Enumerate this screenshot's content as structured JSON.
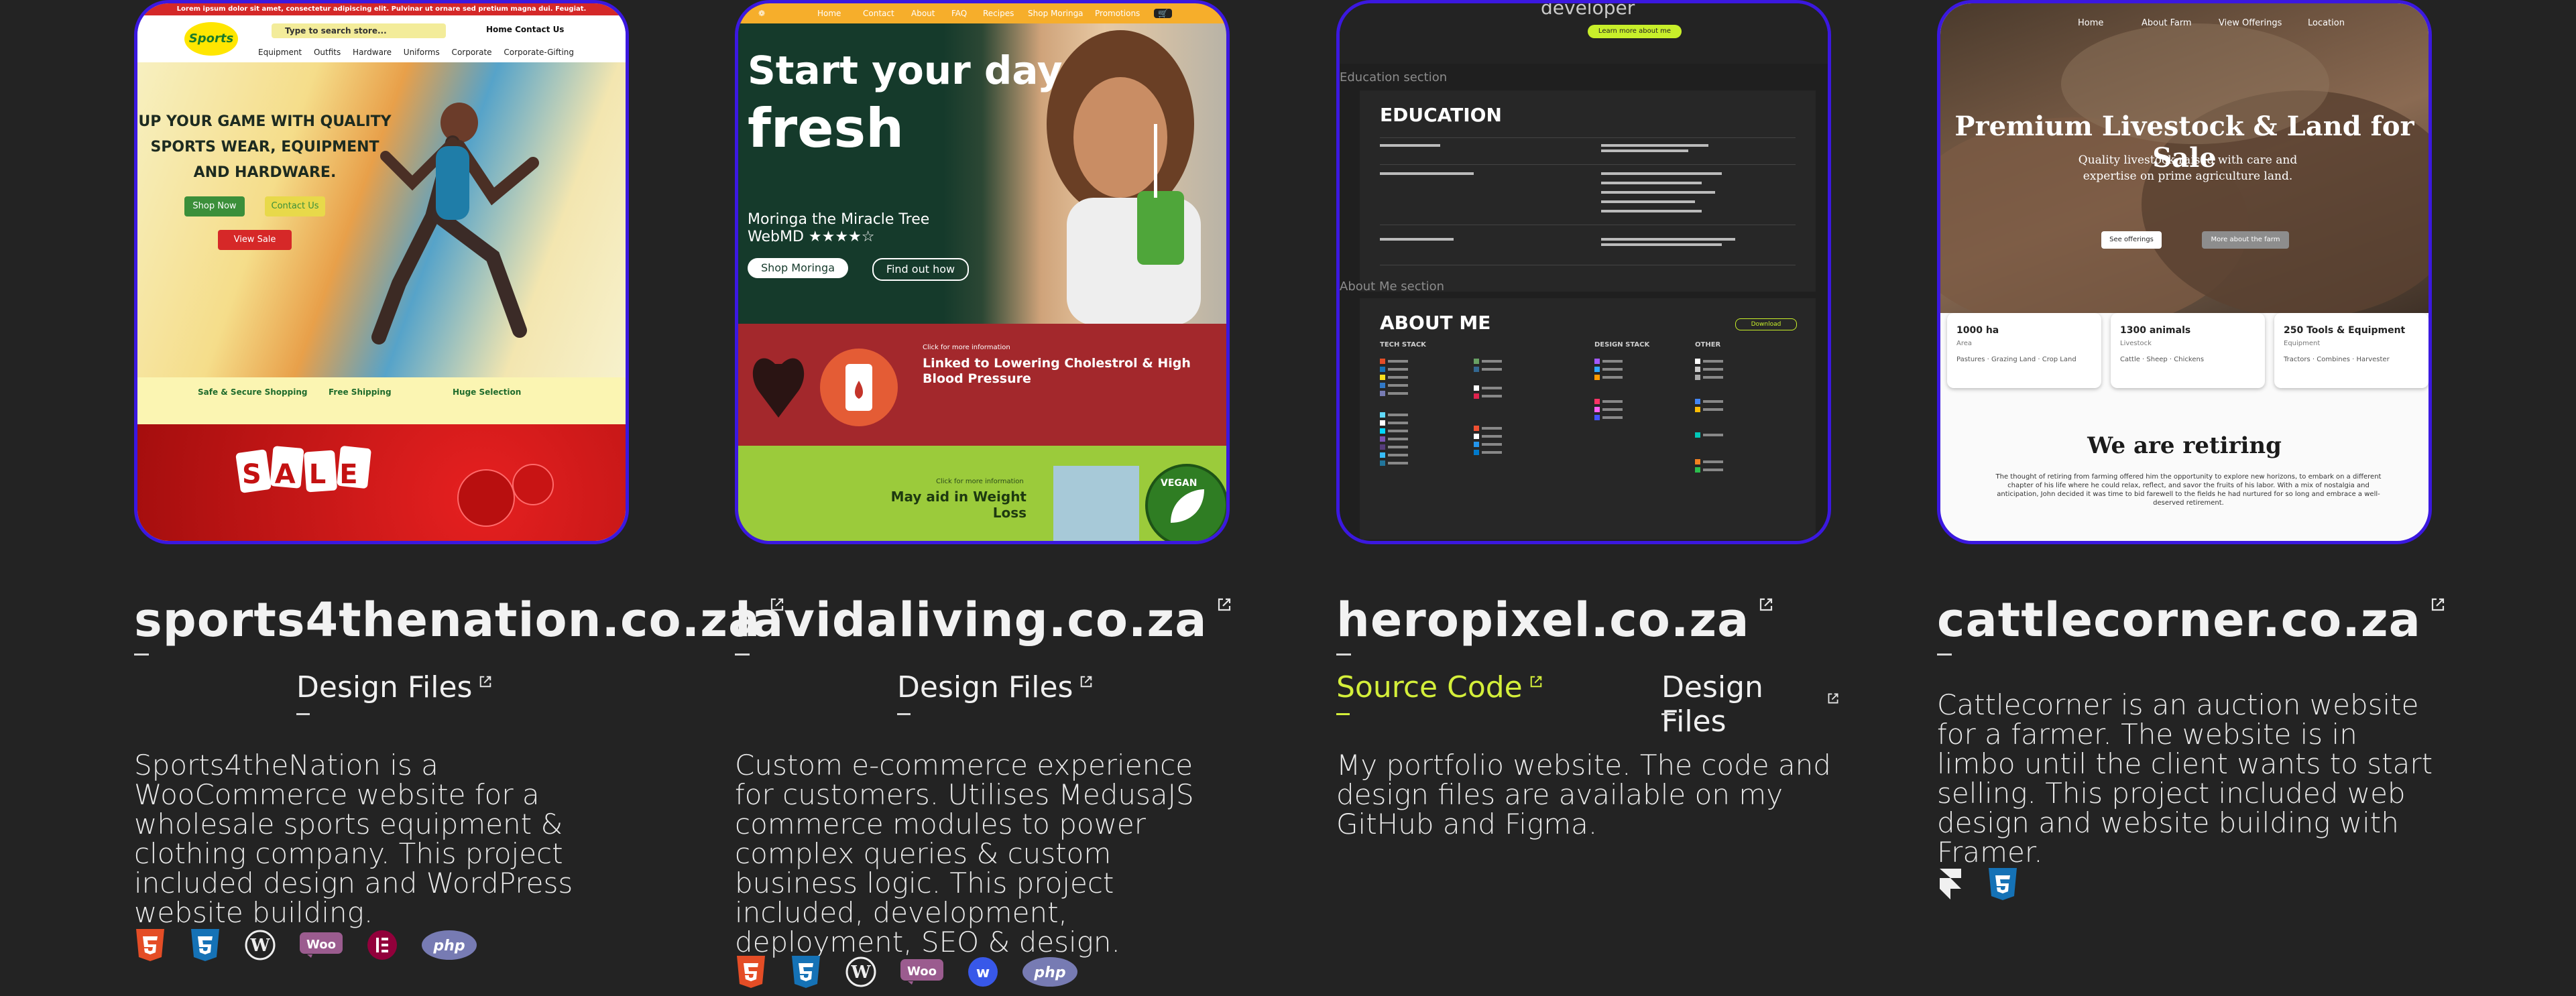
{
  "colors": {
    "background": "#232323",
    "border_accent": "#3b18e0",
    "source_link": "#d4ef3a"
  },
  "projects": [
    {
      "title": "sports4thenation.co.za",
      "links": [
        {
          "label": "Design Files",
          "kind": "design"
        }
      ],
      "description": "Sports4theNation is a WooCommerce website for a wholesale sports equipment & clothing company. This project included design and WordPress website building.",
      "tech": [
        "html5-icon",
        "css3-icon",
        "wordpress-icon",
        "woocommerce-icon",
        "elementor-icon",
        "php-icon"
      ],
      "thumb": {
        "banner": "Lorem ipsum dolor sit amet, consectetur adipiscing elit. Pulvinar ut ornare sed pretium magna dui. Feugiat.",
        "logo": "Sports",
        "search": "Type to search store...",
        "top_nav": "Home   Contact Us",
        "menu": "Equipment Outfits Hardware Uniforms Corporate Corporate-Gifting",
        "headline": "UP YOUR GAME WITH QUALITY SPORTS WEAR, EQUIPMENT AND HARDWARE.",
        "shop_now": "Shop Now",
        "contact_us": "Contact Us",
        "view_sale": "View Sale",
        "feat1": "Safe & Secure Shopping",
        "feat2": "Free Shipping",
        "feat3": "Huge Selection",
        "sale": "SALE"
      }
    },
    {
      "title": "lavidaliving.co.za",
      "links": [
        {
          "label": "Design Files",
          "kind": "design"
        }
      ],
      "description": "Custom e-commerce experience for customers. Utilises MedusaJS commerce modules to power complex queries & custom business logic. This project included, development, deployment, SEO & design.",
      "tech": [
        "html5-icon",
        "css3-icon",
        "wordpress-icon",
        "woocommerce-icon",
        "webflow-icon",
        "php-icon"
      ],
      "thumb": {
        "nav": [
          "Home",
          "Contact",
          "About",
          "FAQ",
          "Recipes",
          "Shop Moringa",
          "Promotions"
        ],
        "line1": "Start your day",
        "line2": "fresh",
        "tag": "Moringa the Miracle Tree",
        "webmd": "WebMD ★★★★☆",
        "shop": "Shop Moringa",
        "find": "Find out how",
        "red_head": "Linked to Lowering Cholestrol & High Blood Pressure",
        "red_more": "Click for more information",
        "green_head": "May aid in Weight Loss",
        "green_more": "Click for more information",
        "vegan": "VEGAN"
      }
    },
    {
      "title": "heropixel.co.za",
      "links": [
        {
          "label": "Source Code",
          "kind": "source"
        },
        {
          "label": "Design Files",
          "kind": "design"
        }
      ],
      "description": "My portfolio website. The code and design files are available on my GitHub and Figma.",
      "tech": [],
      "thumb": {
        "dev": "developer",
        "learn": "Learn more about me",
        "edu_section": "Education section",
        "edu_head": "EDUCATION",
        "about_section": "About Me section",
        "about_head": "ABOUT ME",
        "tech_stack": "TECH STACK",
        "design_stack": "DESIGN STACK",
        "other": "OTHER",
        "download": "Download"
      }
    },
    {
      "title": "cattlecorner.co.za",
      "links": [],
      "description": "Cattlecorner is an auction website for a farmer. The website is in limbo until the client wants to start selling. This project included web design and website building with Framer.",
      "tech": [
        "framer-icon",
        "css3-icon"
      ],
      "thumb": {
        "nav": [
          "Home",
          "About Farm",
          "View Offerings",
          "Location"
        ],
        "headline": "Premium Livestock & Land for Sale",
        "sub": "Quality livestock raised with care and expertise on prime agriculture land.",
        "see": "See offerings",
        "more": "More about the farm",
        "stats": [
          {
            "n": "1000 ha",
            "s": "Area",
            "t": "Pastures · Grazing Land · Crop Land"
          },
          {
            "n": "1300 animals",
            "s": "Livestock",
            "t": "Cattle · Sheep · Chickens"
          },
          {
            "n": "250 Tools & Equipment",
            "s": "Equipment",
            "t": "Tractors · Combines · Harvester"
          }
        ],
        "retiring": "We are retiring",
        "retiring_text": "The thought of retiring from farming offered him the opportunity to explore new horizons, to embark on a different chapter of his life where he could relax, reflect, and savor the fruits of his labor. With a mix of nostalgia and anticipation, John decided it was time to bid farewell to the fields he had nurtured for so long and embrace a well-deserved retirement."
      }
    }
  ]
}
